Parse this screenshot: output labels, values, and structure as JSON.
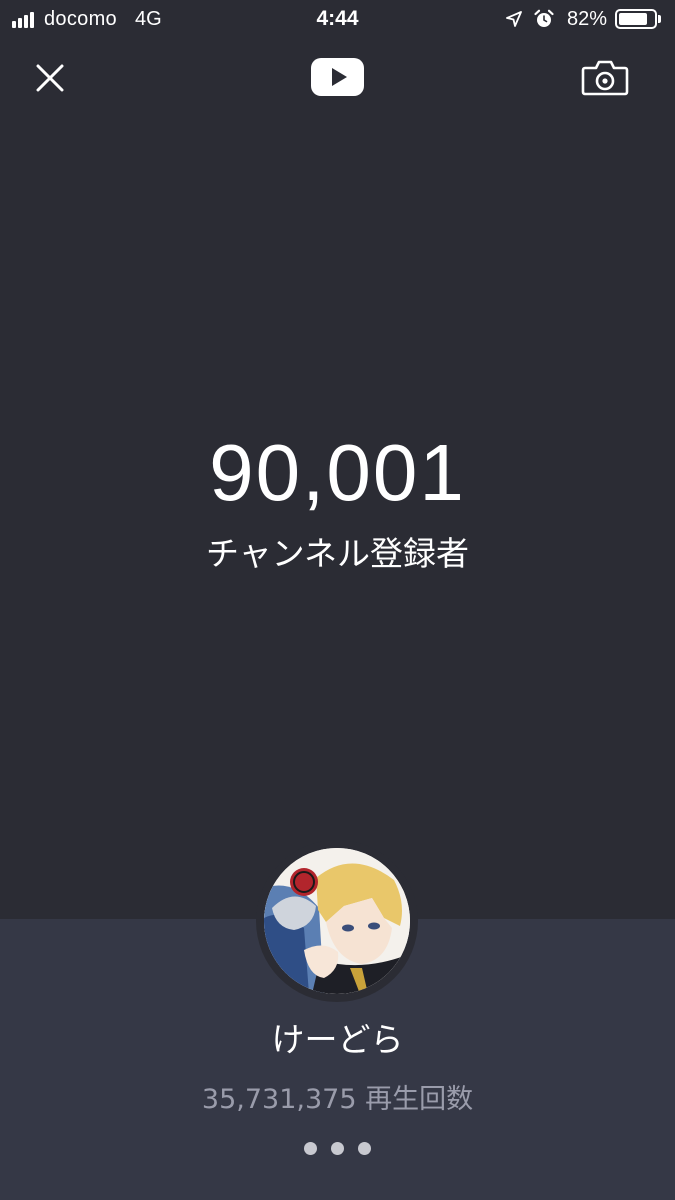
{
  "status_bar": {
    "carrier": "docomo",
    "network": "4G",
    "time": "4:44",
    "battery_percent": "82%",
    "battery_level": 0.82,
    "icons": [
      "signal-bars-icon",
      "location-arrow-icon",
      "alarm-clock-icon",
      "battery-icon"
    ]
  },
  "top_bar": {
    "close_icon": "close-icon",
    "logo_icon": "youtube-logo-icon",
    "camera_icon": "camera-icon"
  },
  "stats": {
    "subscriber_count": "90,001",
    "subscriber_label": "チャンネル登録者"
  },
  "channel": {
    "name": "けーどら",
    "view_count": "35,731,375",
    "view_label": "再生回数",
    "avatar_icon": "channel-avatar"
  },
  "pager": {
    "dot_count": 3
  },
  "colors": {
    "background": "#2b2c34",
    "panel": "#353846",
    "text_primary": "#ffffff",
    "text_secondary": "#9a9cab"
  }
}
